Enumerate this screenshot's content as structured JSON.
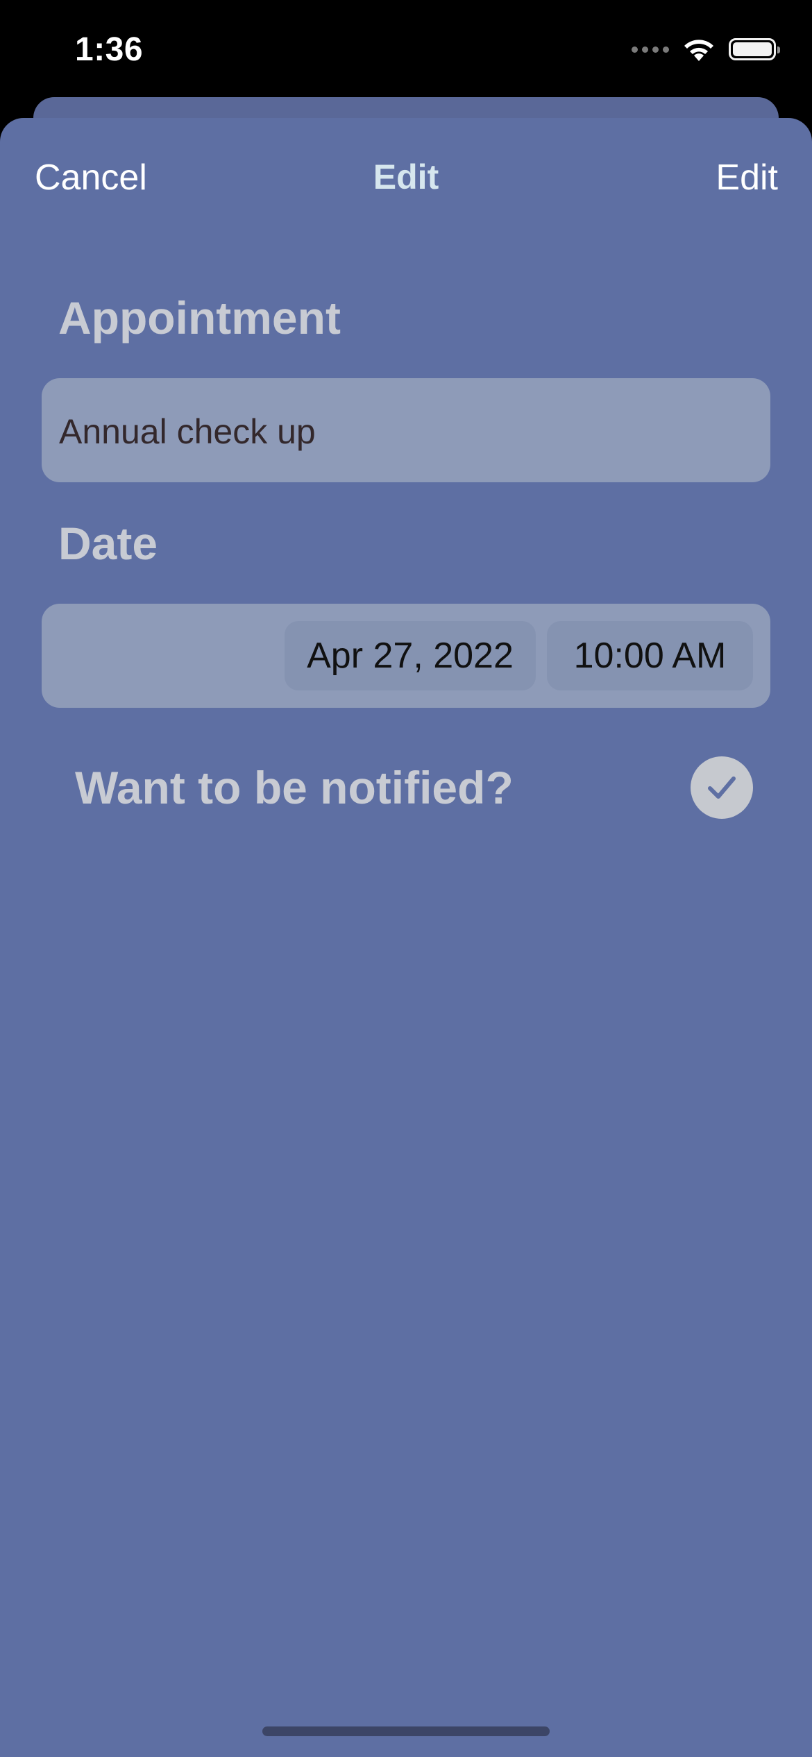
{
  "status_bar": {
    "time": "1:36",
    "icons": [
      "signal-dots-icon",
      "wifi-icon",
      "battery-icon"
    ],
    "battery_level": 1.0
  },
  "nav": {
    "cancel_label": "Cancel",
    "title": "Edit",
    "edit_label": "Edit"
  },
  "form": {
    "appointment_label": "Appointment",
    "appointment_value": "Annual check up",
    "date_label": "Date",
    "date_value": "Apr 27, 2022",
    "time_value": "10:00 AM",
    "notify_label": "Want to be notified?",
    "notify_checked": true
  },
  "colors": {
    "sheet_background": "#5e6fa3",
    "field_background": "#8e9bb8",
    "label_color": "#c8cbd3",
    "title_color": "#d6e6ee",
    "check_color": "#5e6fa3"
  }
}
